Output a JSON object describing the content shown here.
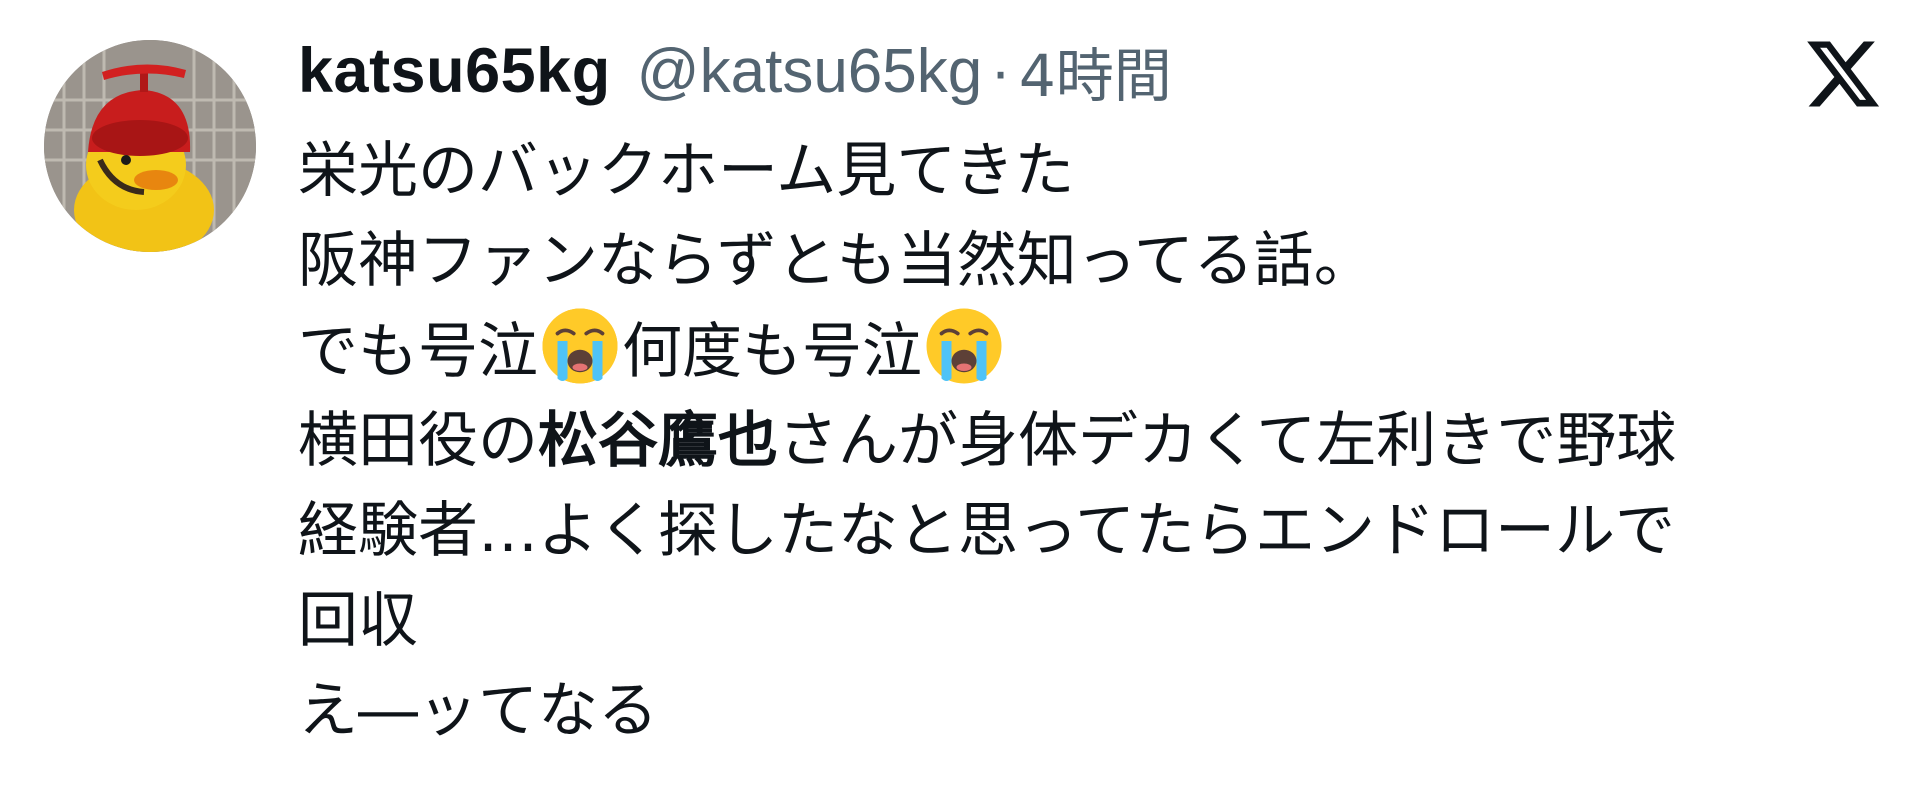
{
  "tweet": {
    "author": {
      "display_name": "katsu65kg",
      "handle": "@katsu65kg",
      "separator": "·",
      "timestamp": "4時間"
    },
    "lines": {
      "l1": "栄光のバックホーム見てきた",
      "l2": "阪神ファンならずとも当然知ってる話。",
      "l3a": "でも号泣",
      "l3b": "何度も号泣",
      "l4a": "横田役の",
      "l4b": "松谷鷹也",
      "l4c": "さんが身体デカくて左利きで野球",
      "l5": "経験者…よく探したなと思ってたらエンドロールで",
      "l6": "回収",
      "l7": "え―ッてなる"
    },
    "emoji": "loudly-crying-face",
    "brand_logo": "x-logo-icon"
  },
  "colors": {
    "text_primary": "#0f1419",
    "text_secondary": "#536471",
    "background": "#ffffff"
  }
}
